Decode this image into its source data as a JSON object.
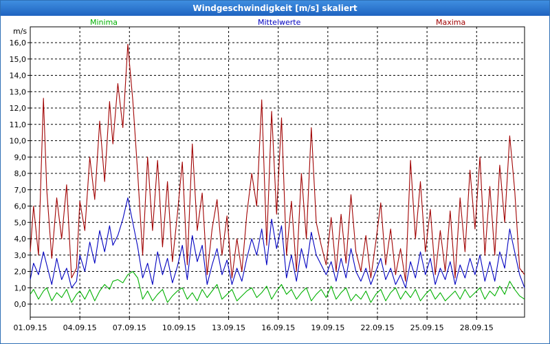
{
  "window": {
    "title": "Windgeschwindigkeit [m/s] skaliert"
  },
  "legend": {
    "min_label": "Minima",
    "mean_label": "Mittelwerte",
    "max_label": "Maxima"
  },
  "colors": {
    "min": "#00b000",
    "mean": "#0000c0",
    "max": "#a00000"
  },
  "chart_data": {
    "type": "line",
    "title": "Windgeschwindigkeit [m/s] skaliert",
    "ylabel": "m/s",
    "xlabel": "",
    "ylim": [
      0,
      16
    ],
    "grid": true,
    "legend_position": "top",
    "yticks": [
      "0,0",
      "1,0",
      "2,0",
      "3,0",
      "4,0",
      "5,0",
      "6,0",
      "7,0",
      "8,0",
      "9,0",
      "10,0",
      "11,0",
      "12,0",
      "13,0",
      "14,0",
      "15,0",
      "16,0"
    ],
    "xticks": [
      "01.09.15",
      "04.09.15",
      "07.09.15",
      "10.09.15",
      "13.09.15",
      "16.09.15",
      "19.09.15",
      "22.09.15",
      "25.09.15",
      "28.09.15"
    ],
    "x_start_day": 1,
    "x_end_day": 30.9,
    "series": [
      {
        "name": "Minima",
        "color": "#00b000",
        "x": [
          1.0,
          1.2,
          1.5,
          1.8,
          2.0,
          2.3,
          2.6,
          2.9,
          3.2,
          3.5,
          3.8,
          4.0,
          4.3,
          4.6,
          4.9,
          5.2,
          5.5,
          5.8,
          6.0,
          6.3,
          6.6,
          6.9,
          7.2,
          7.5,
          7.8,
          8.1,
          8.4,
          8.7,
          9.0,
          9.3,
          9.6,
          9.9,
          10.2,
          10.5,
          10.8,
          11.1,
          11.4,
          11.7,
          12.0,
          12.3,
          12.6,
          12.9,
          13.2,
          13.5,
          13.8,
          14.1,
          14.4,
          14.7,
          15.0,
          15.3,
          15.6,
          15.9,
          16.2,
          16.5,
          16.8,
          17.1,
          17.4,
          17.7,
          18.0,
          18.3,
          18.6,
          18.9,
          19.2,
          19.5,
          19.8,
          20.1,
          20.4,
          20.7,
          21.0,
          21.3,
          21.6,
          21.9,
          22.2,
          22.5,
          22.8,
          23.1,
          23.4,
          23.7,
          24.0,
          24.3,
          24.6,
          24.9,
          25.2,
          25.5,
          25.8,
          26.1,
          26.4,
          26.7,
          27.0,
          27.3,
          27.6,
          27.9,
          28.2,
          28.5,
          28.8,
          29.1,
          29.4,
          29.7,
          30.0,
          30.3,
          30.6,
          30.9
        ],
        "y": [
          0.6,
          0.9,
          0.3,
          0.8,
          1.0,
          0.2,
          0.7,
          0.4,
          0.9,
          0.1,
          0.6,
          0.8,
          0.3,
          0.9,
          0.2,
          0.8,
          1.2,
          0.9,
          1.4,
          1.5,
          1.3,
          1.8,
          2.0,
          1.6,
          0.3,
          0.8,
          0.2,
          0.6,
          0.9,
          0.1,
          0.5,
          0.8,
          1.0,
          0.3,
          0.7,
          0.2,
          0.9,
          0.4,
          0.8,
          1.2,
          0.3,
          0.6,
          0.9,
          0.2,
          0.5,
          0.8,
          1.0,
          0.4,
          0.7,
          1.1,
          0.3,
          0.8,
          1.2,
          0.6,
          0.9,
          0.3,
          0.7,
          1.0,
          0.2,
          0.6,
          0.9,
          0.4,
          1.1,
          0.3,
          0.7,
          1.0,
          0.2,
          0.6,
          0.3,
          0.8,
          0.1,
          0.6,
          0.9,
          0.2,
          0.7,
          1.0,
          0.3,
          0.8,
          0.4,
          0.9,
          0.2,
          0.6,
          0.9,
          0.3,
          0.7,
          0.2,
          0.5,
          0.8,
          0.3,
          0.9,
          0.4,
          0.7,
          1.0,
          0.3,
          0.8,
          0.5,
          1.1,
          0.6,
          1.4,
          0.9,
          0.5,
          0.3
        ]
      },
      {
        "name": "Mittelwerte",
        "color": "#0000c0",
        "x": [
          1.0,
          1.2,
          1.5,
          1.8,
          2.0,
          2.3,
          2.6,
          2.9,
          3.2,
          3.5,
          3.8,
          4.0,
          4.3,
          4.6,
          4.9,
          5.2,
          5.5,
          5.8,
          6.0,
          6.3,
          6.6,
          6.9,
          7.2,
          7.5,
          7.8,
          8.1,
          8.4,
          8.7,
          9.0,
          9.3,
          9.6,
          9.9,
          10.2,
          10.5,
          10.8,
          11.1,
          11.4,
          11.7,
          12.0,
          12.3,
          12.6,
          12.9,
          13.2,
          13.5,
          13.8,
          14.1,
          14.4,
          14.7,
          15.0,
          15.3,
          15.6,
          15.9,
          16.2,
          16.5,
          16.8,
          17.1,
          17.4,
          17.7,
          18.0,
          18.3,
          18.6,
          18.9,
          19.2,
          19.5,
          19.8,
          20.1,
          20.4,
          20.7,
          21.0,
          21.3,
          21.6,
          21.9,
          22.2,
          22.5,
          22.8,
          23.1,
          23.4,
          23.7,
          24.0,
          24.3,
          24.6,
          24.9,
          25.2,
          25.5,
          25.8,
          26.1,
          26.4,
          26.7,
          27.0,
          27.3,
          27.6,
          27.9,
          28.2,
          28.5,
          28.8,
          29.1,
          29.4,
          29.7,
          30.0,
          30.3,
          30.6,
          30.9
        ],
        "y": [
          1.5,
          2.5,
          1.8,
          3.2,
          2.4,
          1.2,
          2.8,
          1.5,
          2.2,
          1.0,
          1.4,
          3.0,
          2.0,
          3.8,
          2.5,
          4.5,
          3.2,
          4.8,
          3.6,
          4.2,
          5.2,
          6.5,
          5.0,
          3.5,
          1.6,
          2.5,
          1.2,
          3.2,
          1.8,
          2.8,
          1.3,
          2.3,
          3.6,
          1.5,
          4.2,
          2.6,
          3.6,
          1.2,
          2.4,
          3.4,
          1.8,
          2.7,
          1.2,
          2.2,
          1.4,
          2.8,
          4.0,
          3.0,
          4.6,
          2.4,
          5.2,
          3.4,
          4.8,
          1.6,
          3.0,
          1.4,
          3.4,
          2.2,
          4.4,
          3.0,
          2.4,
          1.8,
          2.6,
          1.4,
          2.8,
          1.6,
          3.4,
          2.0,
          1.4,
          2.2,
          1.2,
          2.0,
          2.8,
          1.5,
          2.2,
          1.2,
          1.8,
          1.0,
          2.6,
          1.6,
          3.2,
          1.8,
          2.8,
          1.2,
          2.2,
          1.5,
          2.6,
          1.2,
          2.4,
          1.6,
          2.8,
          1.8,
          3.0,
          1.4,
          2.6,
          1.4,
          3.2,
          2.2,
          4.6,
          3.2,
          1.8,
          1.0
        ]
      },
      {
        "name": "Maxima",
        "color": "#a00000",
        "x": [
          1.0,
          1.2,
          1.5,
          1.8,
          2.0,
          2.3,
          2.6,
          2.9,
          3.2,
          3.5,
          3.8,
          4.0,
          4.3,
          4.6,
          4.9,
          5.2,
          5.5,
          5.8,
          6.0,
          6.3,
          6.6,
          6.9,
          7.2,
          7.5,
          7.8,
          8.1,
          8.4,
          8.7,
          9.0,
          9.3,
          9.6,
          9.9,
          10.2,
          10.5,
          10.8,
          11.1,
          11.4,
          11.7,
          12.0,
          12.3,
          12.6,
          12.9,
          13.2,
          13.5,
          13.8,
          14.1,
          14.4,
          14.7,
          15.0,
          15.3,
          15.6,
          15.9,
          16.2,
          16.5,
          16.8,
          17.1,
          17.4,
          17.7,
          18.0,
          18.3,
          18.6,
          18.9,
          19.2,
          19.5,
          19.8,
          20.1,
          20.4,
          20.7,
          21.0,
          21.3,
          21.6,
          21.9,
          22.2,
          22.5,
          22.8,
          23.1,
          23.4,
          23.7,
          24.0,
          24.3,
          24.6,
          24.9,
          25.2,
          25.5,
          25.8,
          26.1,
          26.4,
          26.7,
          27.0,
          27.3,
          27.6,
          27.9,
          28.2,
          28.5,
          28.8,
          29.1,
          29.4,
          29.7,
          30.0,
          30.3,
          30.6,
          30.9
        ],
        "y": [
          3.2,
          6.0,
          3.0,
          12.6,
          7.0,
          2.8,
          6.5,
          4.0,
          7.3,
          1.6,
          2.2,
          6.3,
          4.5,
          9.0,
          6.4,
          11.2,
          7.5,
          12.4,
          9.8,
          13.5,
          10.8,
          15.9,
          12.5,
          8.0,
          3.0,
          9.0,
          4.5,
          8.8,
          3.5,
          7.5,
          2.6,
          5.5,
          8.7,
          2.4,
          9.8,
          4.5,
          6.8,
          1.8,
          4.6,
          6.4,
          3.0,
          5.4,
          1.6,
          4.0,
          2.0,
          5.5,
          8.0,
          6.0,
          12.5,
          3.6,
          11.8,
          5.5,
          11.4,
          3.0,
          6.3,
          2.0,
          8.0,
          4.0,
          10.8,
          5.0,
          3.6,
          2.4,
          5.3,
          2.0,
          5.5,
          2.5,
          6.7,
          3.2,
          2.0,
          4.2,
          1.6,
          3.8,
          6.2,
          2.4,
          4.6,
          1.8,
          3.4,
          1.4,
          8.8,
          4.0,
          7.5,
          3.2,
          5.8,
          1.8,
          4.5,
          2.0,
          5.7,
          1.6,
          6.5,
          3.2,
          8.2,
          4.6,
          9.0,
          3.0,
          7.2,
          3.0,
          8.5,
          5.0,
          10.3,
          7.0,
          2.2,
          1.8
        ]
      }
    ]
  }
}
